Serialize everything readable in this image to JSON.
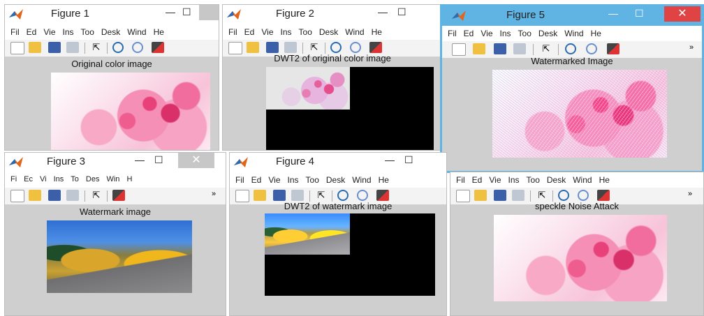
{
  "menu_items": [
    "Fil",
    "Ed",
    "Vie",
    "Ins",
    "Too",
    "Desk",
    "Wind",
    "He"
  ],
  "menu_items_small": [
    "Fi",
    "Ec",
    "Vi",
    "Ins",
    "To",
    "Des",
    "Win",
    "H"
  ],
  "window_controls": {
    "minimize": "—",
    "maximize": "☐",
    "close": "✕",
    "more": "»"
  },
  "windows": {
    "fig1": {
      "title": "Figure 1",
      "caption": "Original color image"
    },
    "fig2": {
      "title": "Figure 2",
      "caption": "DWT2 of original color image"
    },
    "fig5": {
      "title": "Figure 5",
      "caption": "Watermarked Image"
    },
    "fig3": {
      "title": "Figure 3",
      "caption": "Watermark image"
    },
    "fig4": {
      "title": "Figure 4",
      "caption": "DWT2 of watermark image"
    },
    "fig6": {
      "caption": "speckle Noise Attack"
    }
  },
  "colors": {
    "active_border": "#5fb4e4",
    "close_red": "#e04343",
    "figure_bg": "#cfcfcf"
  },
  "icons": [
    "matlab-logo-icon",
    "new-file-icon",
    "open-folder-icon",
    "save-icon",
    "print-icon",
    "pointer-icon",
    "zoom-in-icon",
    "zoom-out-icon",
    "brush-icon"
  ]
}
